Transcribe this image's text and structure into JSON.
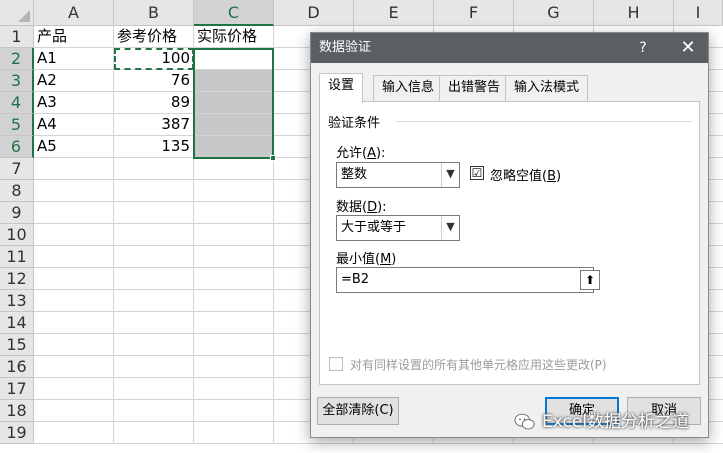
{
  "sheet": {
    "columns": [
      "A",
      "B",
      "C",
      "D",
      "E",
      "F",
      "G",
      "H",
      "I"
    ],
    "rows": [
      "1",
      "2",
      "3",
      "4",
      "5",
      "6",
      "7",
      "8",
      "9",
      "10",
      "11",
      "12",
      "13",
      "14",
      "15",
      "16",
      "17",
      "18",
      "19"
    ],
    "header_row": {
      "a": "产品",
      "b": "参考价格",
      "c": "实际价格"
    },
    "data_rows": [
      {
        "a": "A1",
        "b": "100"
      },
      {
        "a": "A2",
        "b": "76"
      },
      {
        "a": "A3",
        "b": "89"
      },
      {
        "a": "A4",
        "b": "387"
      },
      {
        "a": "A5",
        "b": "135"
      }
    ]
  },
  "dialog": {
    "title": "数据验证",
    "help": "?",
    "close": "✕",
    "tabs": [
      "设置",
      "输入信息",
      "出错警告",
      "输入法模式"
    ],
    "group_label": "验证条件",
    "allow": {
      "label_prefix": "允许(",
      "label_key": "A",
      "label_suffix": "):",
      "value": "整数"
    },
    "ignore_blank": {
      "label_prefix": "忽略空值(",
      "label_key": "B",
      "label_suffix": ")",
      "checked": "☑"
    },
    "data": {
      "label_prefix": "数据(",
      "label_key": "D",
      "label_suffix": "):",
      "value": "大于或等于"
    },
    "minimum": {
      "label_prefix": "最小值(",
      "label_key": "M",
      "label_suffix": ")",
      "value": "=B2"
    },
    "apply_all": "对有同样设置的所有其他单元格应用这些更改(P)",
    "clear_all": "全部清除(C)",
    "ok": "确定",
    "cancel": "取消"
  },
  "watermark": "Excel数据分析之道",
  "colors": {
    "accent": "#217346",
    "titlebar": "#5a5f64",
    "focus": "#0078d7"
  }
}
